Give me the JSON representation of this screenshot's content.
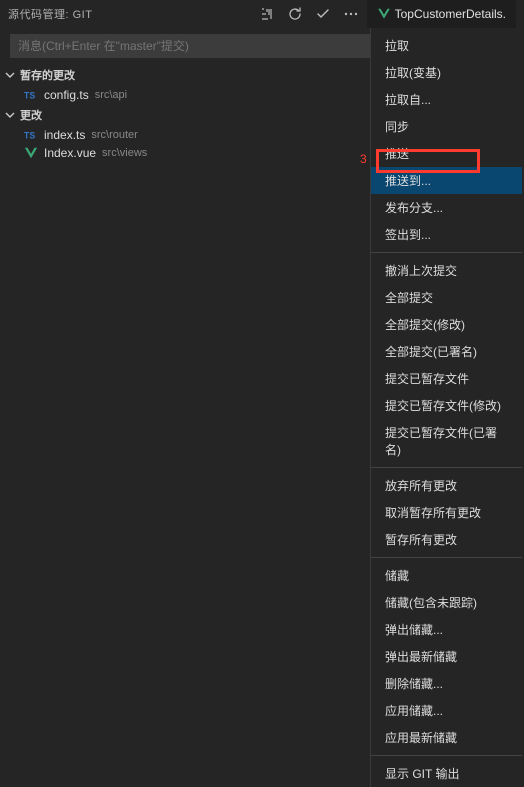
{
  "header": {
    "title": "源代码管理: GIT",
    "tab_text": "TopCustomerDetails."
  },
  "commit": {
    "placeholder": "消息(Ctrl+Enter 在\"master\"提交)"
  },
  "sections": {
    "staged": {
      "label": "暂存的更改"
    },
    "changes": {
      "label": "更改"
    }
  },
  "files": {
    "config": {
      "name": "config.ts",
      "path": "src\\api"
    },
    "index_ts": {
      "name": "index.ts",
      "path": "src\\router"
    },
    "index_vue": {
      "name": "Index.vue",
      "path": "src\\views"
    }
  },
  "menu": {
    "pull": "拉取",
    "pull_rebase": "拉取(变基)",
    "pull_from": "拉取自...",
    "sync": "同步",
    "push": "推送",
    "push_to": "推送到...",
    "publish_branch": "发布分支...",
    "checkout_to": "签出到...",
    "undo_last_commit": "撤消上次提交",
    "commit_all": "全部提交",
    "commit_all_amend": "全部提交(修改)",
    "commit_all_signed": "全部提交(已署名)",
    "commit_staged": "提交已暂存文件",
    "commit_staged_amend": "提交已暂存文件(修改)",
    "commit_staged_signed": "提交已暂存文件(已署名)",
    "discard_all": "放弃所有更改",
    "unstage_all": "取消暂存所有更改",
    "stage_all": "暂存所有更改",
    "stash": "储藏",
    "stash_include_untracked": "储藏(包含未跟踪)",
    "pop_stash": "弹出储藏...",
    "pop_latest_stash": "弹出最新储藏",
    "drop_stash": "删除储藏...",
    "apply_stash": "应用储藏...",
    "apply_latest_stash": "应用最新储藏",
    "show_git_output": "显示 GIT 输出"
  },
  "annotation": {
    "label": "3"
  }
}
